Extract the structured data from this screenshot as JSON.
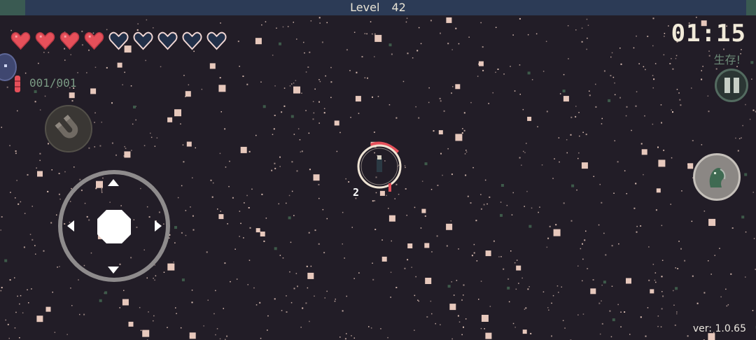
{
  "hud": {
    "level_label": "Level",
    "level_value": "42",
    "timer": "01:15",
    "status_text": "生存!",
    "ammo": "001/001",
    "version": "ver: 1.0.65",
    "combo_count": "2"
  },
  "health": {
    "hearts_total": 9,
    "hearts_full": 4
  },
  "controls": {
    "pause_icon": "pause-icon",
    "magnet_icon": "magnet-icon",
    "skill_icon": "ghost-skill-icon",
    "joystick_icon": "dpad-joystick"
  },
  "colors": {
    "background": "#221d27",
    "heart_full": "#e6505a",
    "heart_empty": "#223049",
    "heart_outline": "#f1d7d4",
    "particle": "#f2d2c4",
    "level_bar": "#2c3b56",
    "accent_green": "#6c8a77"
  }
}
